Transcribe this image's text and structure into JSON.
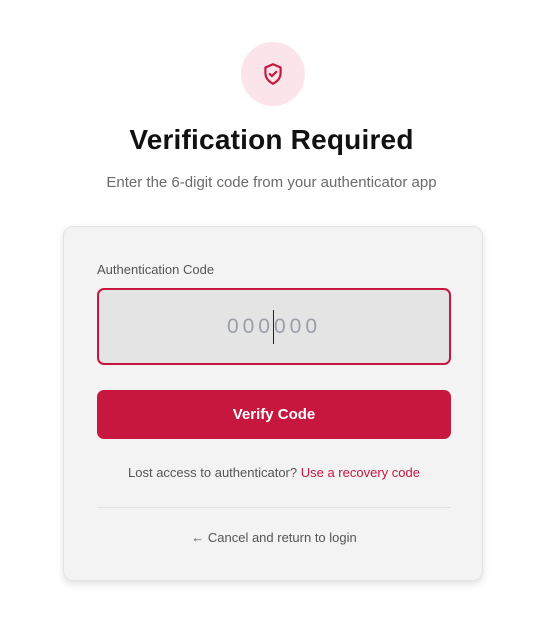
{
  "header": {
    "icon": "shield-check-icon",
    "title": "Verification Required",
    "subtitle": "Enter the 6-digit code from your authenticator app"
  },
  "form": {
    "code_label": "Authentication Code",
    "code_value": "",
    "code_placeholder": "000000",
    "submit_label": "Verify Code"
  },
  "recovery": {
    "prompt": "Lost access to authenticator?",
    "link_label": "Use a recovery code"
  },
  "cancel": {
    "label": "← Cancel and return to login"
  },
  "colors": {
    "accent": "#c8173f",
    "icon_bg": "#fbe5ea",
    "card_bg": "#f3f3f3",
    "input_bg": "#e4e4e4"
  }
}
